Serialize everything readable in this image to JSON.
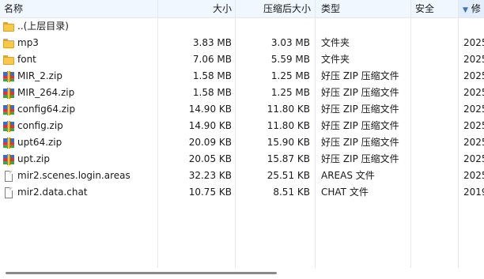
{
  "columns": [
    {
      "key": "name",
      "label": "名称"
    },
    {
      "key": "size",
      "label": "大小"
    },
    {
      "key": "packed",
      "label": "压缩后大小"
    },
    {
      "key": "type",
      "label": "类型"
    },
    {
      "key": "attr",
      "label": "安全"
    },
    {
      "key": "modified",
      "label": "修",
      "sort_indicator": "down-arrow-icon"
    }
  ],
  "files": [
    {
      "name": "..(上层目录)",
      "size": "",
      "packed": "",
      "type": "",
      "attr": "",
      "modified": "",
      "icon": "folder-icon"
    },
    {
      "name": "mp3",
      "size": "3.83 MB",
      "packed": "3.03 MB",
      "type": "文件夹",
      "attr": "",
      "modified": "2025",
      "icon": "folder-icon"
    },
    {
      "name": "font",
      "size": "7.06 MB",
      "packed": "5.59 MB",
      "type": "文件夹",
      "attr": "",
      "modified": "2025",
      "icon": "folder-icon"
    },
    {
      "name": "MIR_2.zip",
      "size": "1.58 MB",
      "packed": "1.25 MB",
      "type": "好压 ZIP 压缩文件",
      "attr": "",
      "modified": "2025",
      "icon": "zip-archive-icon"
    },
    {
      "name": "MIR_264.zip",
      "size": "1.58 MB",
      "packed": "1.25 MB",
      "type": "好压 ZIP 压缩文件",
      "attr": "",
      "modified": "2025",
      "icon": "zip-archive-icon"
    },
    {
      "name": "config64.zip",
      "size": "14.90 KB",
      "packed": "11.80 KB",
      "type": "好压 ZIP 压缩文件",
      "attr": "",
      "modified": "2025",
      "icon": "zip-archive-icon"
    },
    {
      "name": "config.zip",
      "size": "14.90 KB",
      "packed": "11.80 KB",
      "type": "好压 ZIP 压缩文件",
      "attr": "",
      "modified": "2025",
      "icon": "zip-archive-icon"
    },
    {
      "name": "upt64.zip",
      "size": "20.09 KB",
      "packed": "15.90 KB",
      "type": "好压 ZIP 压缩文件",
      "attr": "",
      "modified": "2025",
      "icon": "zip-archive-icon"
    },
    {
      "name": "upt.zip",
      "size": "20.05 KB",
      "packed": "15.87 KB",
      "type": "好压 ZIP 压缩文件",
      "attr": "",
      "modified": "2025",
      "icon": "zip-archive-icon"
    },
    {
      "name": "mir2.scenes.login.areas",
      "size": "32.23 KB",
      "packed": "25.51 KB",
      "type": "AREAS 文件",
      "attr": "",
      "modified": "2025",
      "icon": "file-icon"
    },
    {
      "name": "mir2.data.chat",
      "size": "10.75 KB",
      "packed": "8.51 KB",
      "type": "CHAT 文件",
      "attr": "",
      "modified": "2019",
      "icon": "file-icon"
    }
  ],
  "colors": {
    "header_sorted_bg": "#f0f7ff",
    "header_active_bg": "#e2eefb",
    "grid_line": "#e5e8ec",
    "folder": "#f8c948",
    "scroll_thumb": "#8a8a8a"
  }
}
